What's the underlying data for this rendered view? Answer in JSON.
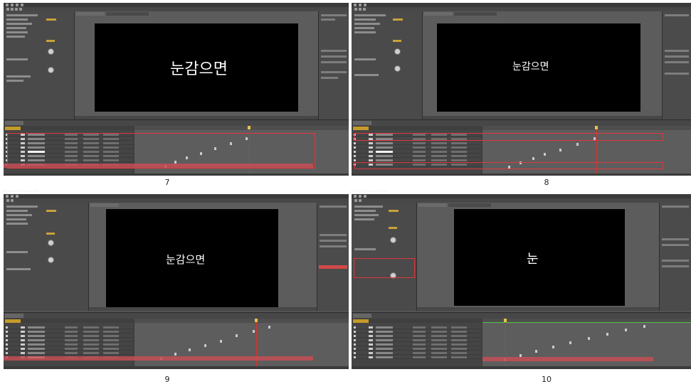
{
  "captions": {
    "p7": "7",
    "p8": "8",
    "p9": "9",
    "p10": "10"
  },
  "panels": {
    "p7": {
      "canvas_text": "눈감으면"
    },
    "p8": {
      "canvas_text": "눈감으면"
    },
    "p9": {
      "canvas_text": "눈감으면"
    },
    "p10": {
      "canvas_text": "눈"
    }
  },
  "colors": {
    "ae_background": "#535353",
    "canvas": "#000000",
    "highlight_red": "#e0353d",
    "keyframe_bar_red": "#c44d55",
    "current_time_indicator": "#e0302c",
    "work_area_green": "#55c24a",
    "timecode_orange": "#c49a2a"
  },
  "icons": [
    "playhead-icon",
    "keyframe-icon",
    "eye-icon",
    "knob-icon"
  ]
}
